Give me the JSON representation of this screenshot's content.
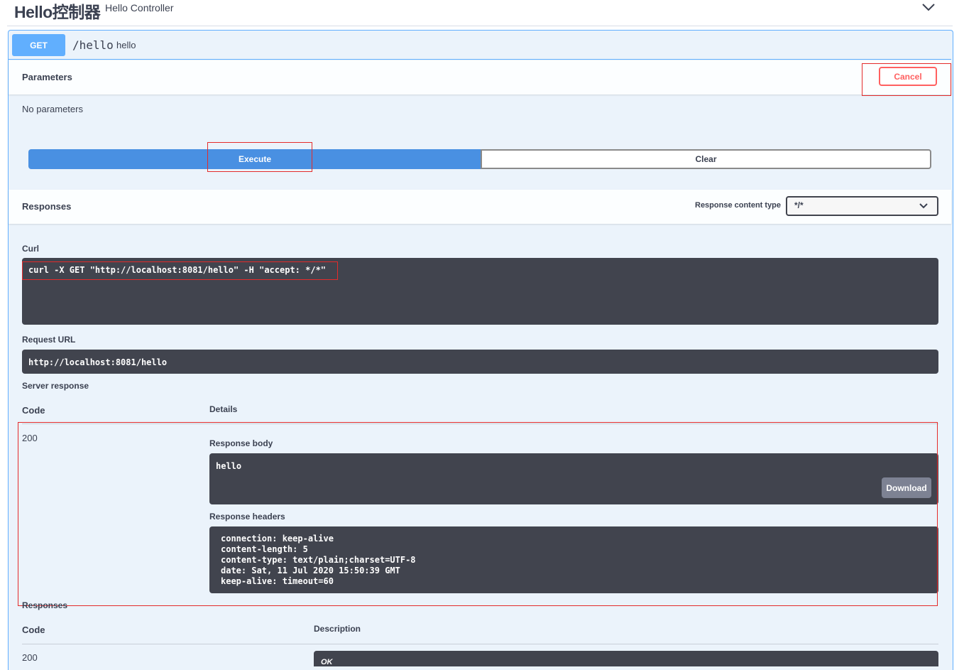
{
  "tag": {
    "title": "Hello控制器",
    "description": "Hello Controller"
  },
  "operation": {
    "method": "GET",
    "path": "/hello",
    "summary": "hello"
  },
  "parameters": {
    "title": "Parameters",
    "cancel_label": "Cancel",
    "empty_text": "No parameters"
  },
  "actions": {
    "execute_label": "Execute",
    "clear_label": "Clear"
  },
  "responses_header": {
    "title": "Responses",
    "content_type_label": "Response content type",
    "content_type_value": "*/*"
  },
  "curl": {
    "label": "Curl",
    "command": "curl -X GET \"http://localhost:8081/hello\" -H \"accept: */*\""
  },
  "request_url": {
    "label": "Request URL",
    "value": "http://localhost:8081/hello"
  },
  "server_response": {
    "label": "Server response",
    "code_header": "Code",
    "details_header": "Details",
    "code": "200",
    "body_label": "Response body",
    "body": "hello",
    "download_label": "Download",
    "headers_label": "Response headers",
    "headers": [
      "connection: keep-alive",
      "content-length: 5",
      "content-type: text/plain;charset=UTF-8",
      "date: Sat, 11 Jul 2020 15:50:39 GMT",
      "keep-alive: timeout=60"
    ]
  },
  "responses_table": {
    "label": "Responses",
    "code_header": "Code",
    "description_header": "Description",
    "rows": [
      {
        "code": "200",
        "description": "OK"
      }
    ]
  },
  "colors": {
    "get": "#61affe",
    "execute": "#4990e2",
    "cancel": "#ff6060",
    "code_bg": "#41444e",
    "highlight": "#e42b2b"
  }
}
